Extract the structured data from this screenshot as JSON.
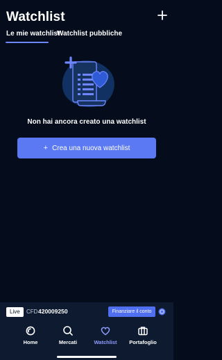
{
  "header": {
    "title": "Watchlist",
    "add_icon": "plus-icon"
  },
  "tabs": [
    {
      "label": "Le mie watchlist",
      "active": true
    },
    {
      "label": "Watchlist pubbliche",
      "active": false
    }
  ],
  "empty_state": {
    "illustration": "watchlist-document-heart-illustration",
    "message": "Non hai ancora creato una watchlist",
    "button_label": "Crea una nuova watchlist"
  },
  "account": {
    "mode": "Live",
    "type": "CFD",
    "number": "420009250",
    "fund_label": "Finanziare il conto",
    "support_icon": "support-icon"
  },
  "nav": [
    {
      "label": "Home",
      "icon": "home-icon",
      "active": false
    },
    {
      "label": "Mercati",
      "icon": "search-icon",
      "active": false
    },
    {
      "label": "Watchlist",
      "icon": "heart-icon",
      "active": true
    },
    {
      "label": "Portafoglio",
      "icon": "briefcase-icon",
      "active": false
    }
  ],
  "colors": {
    "background": "#050d1c",
    "accent": "#5b79f2",
    "active_nav": "#8f9cff"
  }
}
